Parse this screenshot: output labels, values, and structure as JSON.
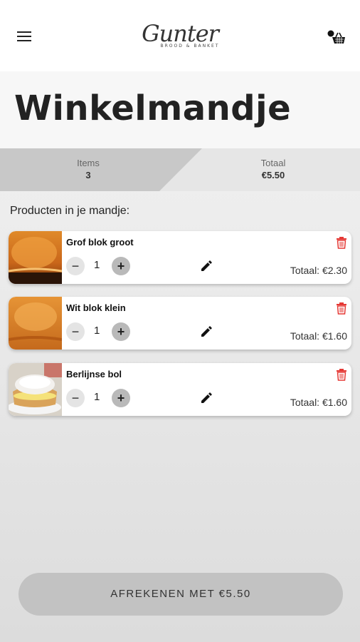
{
  "header": {
    "logo_main": "Gunter",
    "logo_sub": "BROOD & BANKET"
  },
  "page": {
    "title": "Winkelmandje"
  },
  "summary": {
    "items_label": "Items",
    "items_value": "3",
    "total_label": "Totaal",
    "total_value": "€5.50"
  },
  "cart": {
    "section_label": "Producten in je mandje:",
    "items": [
      {
        "name": "Grof blok groot",
        "qty": "1",
        "total": "Totaal: €2.30",
        "image": "bread-loaf"
      },
      {
        "name": "Wit blok klein",
        "qty": "1",
        "total": "Totaal: €1.60",
        "image": "bread-loaf"
      },
      {
        "name": "Berlijnse bol",
        "qty": "1",
        "total": "Totaal: €1.60",
        "image": "berliner"
      }
    ],
    "minus_label": "−",
    "plus_label": "+"
  },
  "checkout": {
    "label": "AFREKENEN MET €5.50"
  },
  "colors": {
    "accent_red": "#e53935",
    "summary_dark": "#c8c8c8",
    "summary_light": "#e6e6e6",
    "button": "#c2c2c2"
  }
}
